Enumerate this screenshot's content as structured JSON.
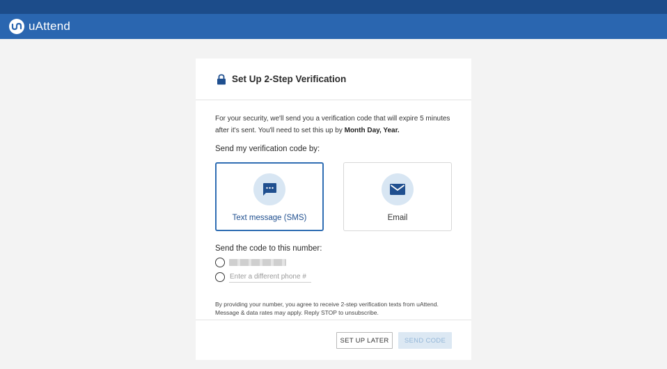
{
  "app": {
    "brand": "uAttend"
  },
  "dialog": {
    "title": "Set Up 2-Step Verification",
    "intro_prefix": "For your security, we'll send you a verification code that will expire 5 minutes after it's sent. You'll need to set this up by ",
    "intro_deadline": "Month Day, Year.",
    "method_label": "Send my verification code by:",
    "methods": [
      {
        "label": "Text message (SMS)",
        "icon": "chat-bubble-icon",
        "selected": true
      },
      {
        "label": "Email",
        "icon": "envelope-icon",
        "selected": false
      }
    ],
    "number_label": "Send the code to this number:",
    "phone_placeholder": "Enter a different phone #",
    "consent": "By providing your number, you agree to receive 2-step verification texts from uAttend. Message & data rates may apply. Reply STOP to unsubscribe.",
    "buttons": {
      "later": "SET UP LATER",
      "send": "SEND CODE"
    }
  },
  "colors": {
    "header": "#2a66b0",
    "header_top": "#1c4c8a",
    "accent": "#2f6db3",
    "icon_bubble": "#d8e6f3"
  }
}
